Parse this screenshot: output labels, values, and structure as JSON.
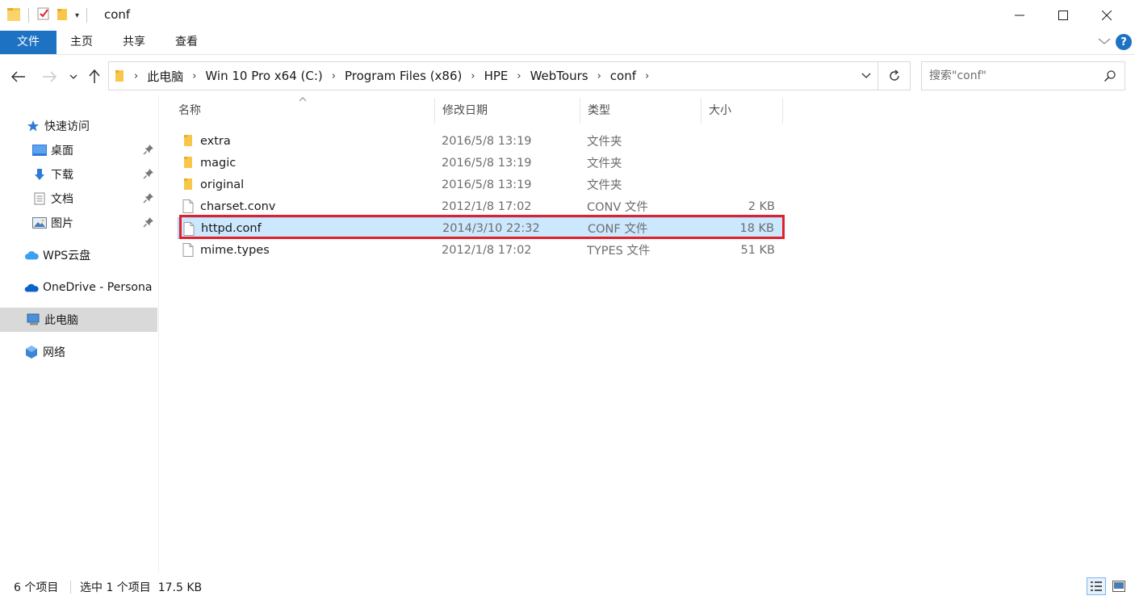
{
  "window": {
    "title": "conf"
  },
  "ribbon": {
    "tabs": [
      {
        "label": "文件"
      },
      {
        "label": "主页"
      },
      {
        "label": "共享"
      },
      {
        "label": "查看"
      }
    ],
    "help_label": "?"
  },
  "address": {
    "crumbs": [
      "此电脑",
      "Win 10 Pro x64 (C:)",
      "Program Files (x86)",
      "HPE",
      "WebTours",
      "conf"
    ],
    "search_placeholder": "搜索\"conf\""
  },
  "sidebar": {
    "items": [
      {
        "label": "快速访问",
        "icon": "star-icon",
        "level": 1,
        "pinned": false
      },
      {
        "label": "桌面",
        "icon": "desktop-icon",
        "level": 2,
        "pinned": true
      },
      {
        "label": "下载",
        "icon": "download-icon",
        "level": 2,
        "pinned": true
      },
      {
        "label": "文档",
        "icon": "document-icon",
        "level": 2,
        "pinned": true
      },
      {
        "label": "图片",
        "icon": "picture-icon",
        "level": 2,
        "pinned": true
      },
      {
        "label": "WPS云盘",
        "icon": "cloud-icon",
        "level": 1,
        "pinned": false
      },
      {
        "label": "OneDrive - Persona",
        "icon": "onedrive-icon",
        "level": 1,
        "pinned": false
      },
      {
        "label": "此电脑",
        "icon": "computer-icon",
        "level": 1,
        "pinned": false,
        "selected": true
      },
      {
        "label": "网络",
        "icon": "network-icon",
        "level": 1,
        "pinned": false
      }
    ]
  },
  "columns": {
    "name": "名称",
    "date": "修改日期",
    "type": "类型",
    "size": "大小"
  },
  "files": [
    {
      "name": "extra",
      "date": "2016/5/8 13:19",
      "type": "文件夹",
      "size": "",
      "kind": "folder"
    },
    {
      "name": "magic",
      "date": "2016/5/8 13:19",
      "type": "文件夹",
      "size": "",
      "kind": "folder"
    },
    {
      "name": "original",
      "date": "2016/5/8 13:19",
      "type": "文件夹",
      "size": "",
      "kind": "folder"
    },
    {
      "name": "charset.conv",
      "date": "2012/1/8 17:02",
      "type": "CONV 文件",
      "size": "2 KB",
      "kind": "file"
    },
    {
      "name": "httpd.conf",
      "date": "2014/3/10 22:32",
      "type": "CONF 文件",
      "size": "18 KB",
      "kind": "file",
      "selected": true
    },
    {
      "name": "mime.types",
      "date": "2012/1/8 17:02",
      "type": "TYPES 文件",
      "size": "51 KB",
      "kind": "file"
    }
  ],
  "status": {
    "item_count": "6 个项目",
    "selection": "选中 1 个项目  17.5 KB"
  },
  "colors": {
    "accent": "#1e72c4",
    "selection_bg": "#cce8ff",
    "annotation_red": "#e3202a",
    "folder_yellow": "#f8c74a"
  }
}
